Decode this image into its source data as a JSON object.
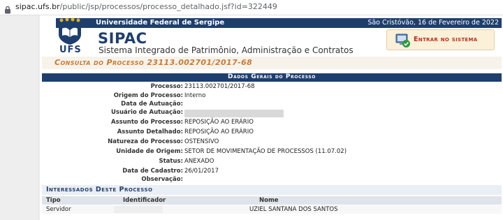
{
  "browser": {
    "url_host": "sipac.ufs.br",
    "url_path": "/public/jsp/processos/processo_detalhado.jsf?id=322449"
  },
  "header": {
    "university": "Universidade Federal de Sergipe",
    "date": "São Cristóvão, 16 de Fevereiro de 2022",
    "app_name": "SIPAC",
    "app_subtitle": "Sistema Integrado de Patrimônio, Administração e Contratos",
    "logo_text": "UFS",
    "enter_button": "Entrar no sistema"
  },
  "page": {
    "consult_title": "Consulta do Processo 23113.002701/2017-68",
    "section_title": "Dados Gerais do Processo"
  },
  "fields": [
    {
      "label": "Processo:",
      "value": "23113.002701/2017-68"
    },
    {
      "label": "Origem do Processo:",
      "value": "Interno"
    },
    {
      "label": "Data de Autuação:",
      "value": ""
    },
    {
      "label": "Usuário de Autuação:",
      "value": ""
    },
    {
      "label": "Assunto do Processo:",
      "value": "REPOSIÇÃO AO ERÁRIO"
    },
    {
      "label": "Assunto Detalhado:",
      "value": "REPOSIÇÃO AO ERÁRIO"
    },
    {
      "label": "Natureza do Processo:",
      "value": "OSTENSIVO"
    },
    {
      "label": "Unidade de Origem:",
      "value": "SETOR DE MOVIMENTAÇÃO DE PROCESSOS (11.07.02)"
    },
    {
      "label": "Status:",
      "value": "ANEXADO"
    },
    {
      "label": "Data de Cadastro:",
      "value": "26/01/2017"
    },
    {
      "label": "Observação:",
      "value": ""
    }
  ],
  "interessados": {
    "title": "Interessados Deste Processo",
    "columns": [
      "Tipo",
      "Identificador",
      "Nome"
    ],
    "rows": [
      {
        "tipo": "Servidor",
        "identificador": "",
        "nome": "UZIEL SANTANA DOS SANTOS"
      }
    ]
  },
  "colors": {
    "primary_navy": "#1e3f6e",
    "accent_orange": "#c87a38",
    "button_red": "#b53221"
  }
}
